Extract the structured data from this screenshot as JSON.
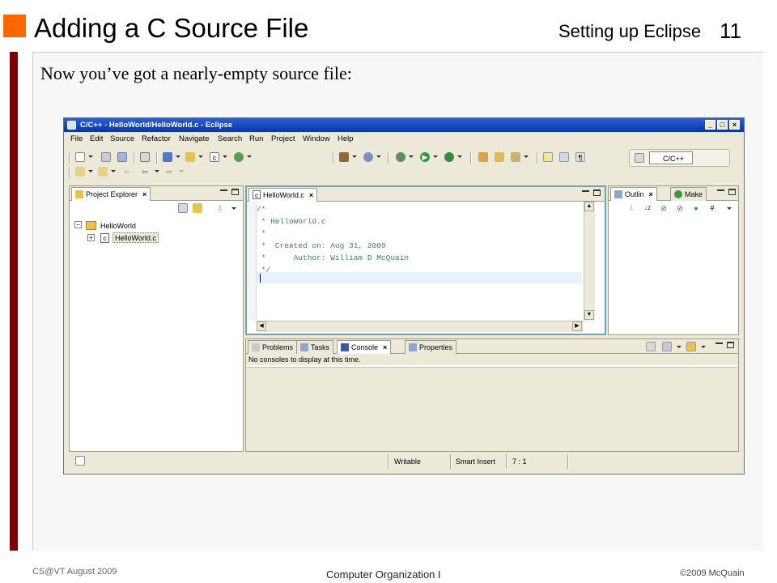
{
  "slide": {
    "title": "Adding a C Source File",
    "section": "Setting up Eclipse",
    "number": "11",
    "text": "Now you’ve got a nearly-empty source file:",
    "footer_left": "CS@VT August 2009",
    "footer_center": "Computer Organization I",
    "footer_right": "©2009  McQuain",
    "colors": {
      "accent_square": "#ff6600",
      "left_bar": "#800000"
    }
  },
  "eclipse": {
    "title": "C/C++ - HelloWorld/HelloWorld.c - Eclipse",
    "window_buttons": [
      "_",
      "□",
      "×"
    ],
    "menu": [
      "File",
      "Edit",
      "Source",
      "Refactor",
      "Navigate",
      "Search",
      "Run",
      "Project",
      "Window",
      "Help"
    ],
    "perspective": "C/C++",
    "project_explorer": {
      "tab": "Project Explorer",
      "tree": [
        {
          "label": "HelloWorld",
          "expander": "−",
          "icon": "project-folder-icon"
        },
        {
          "label": "HelloWorld.c",
          "expander": "+",
          "icon": "c-file-icon"
        }
      ]
    },
    "editor": {
      "tab": "HelloWorld.c",
      "lines": [
        "/*",
        " * HelloWorld.c",
        " *",
        " *  Created on: Aug 31, 2009",
        " *      Author: William D McQuain",
        " */"
      ]
    },
    "outline": {
      "tabs": [
        "Outlin",
        "Make"
      ]
    },
    "console": {
      "tabs": [
        "Problems",
        "Tasks",
        "Console",
        "Properties"
      ],
      "message": "No consoles to display at this time."
    },
    "status": {
      "writable": "Writable",
      "insert_mode": "Smart Insert",
      "position": "7 : 1"
    }
  }
}
